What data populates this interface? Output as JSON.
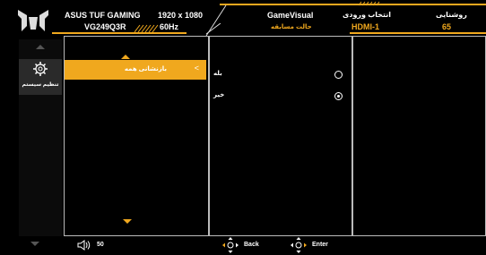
{
  "header": {
    "brand": "ASUS TUF GAMING",
    "model": "VG249Q3R",
    "resolution": "1920 x 1080",
    "refresh": "60Hz",
    "mode_title": "GameVisual",
    "mode_value": "حالت مسابقه",
    "input_title": "انتخاب ورودی",
    "input_value": "HDMI-1",
    "brightness_title": "روشنایی",
    "brightness_value": "65"
  },
  "sidebar": {
    "active_label": "تنظیم سیستم",
    "active_icon": "gear-icon"
  },
  "menu": {
    "items": [
      {
        "label": "بازنشانی همه",
        "chevron": "<"
      }
    ]
  },
  "options": {
    "items": [
      {
        "label": "بله",
        "selected": false
      },
      {
        "label": "خیر",
        "selected": true
      }
    ]
  },
  "footer": {
    "volume": "50",
    "back_label": "Back",
    "enter_label": "Enter"
  },
  "colors": {
    "accent": "#f0a81e",
    "background": "#000000",
    "frame": "#bbbbbb"
  }
}
